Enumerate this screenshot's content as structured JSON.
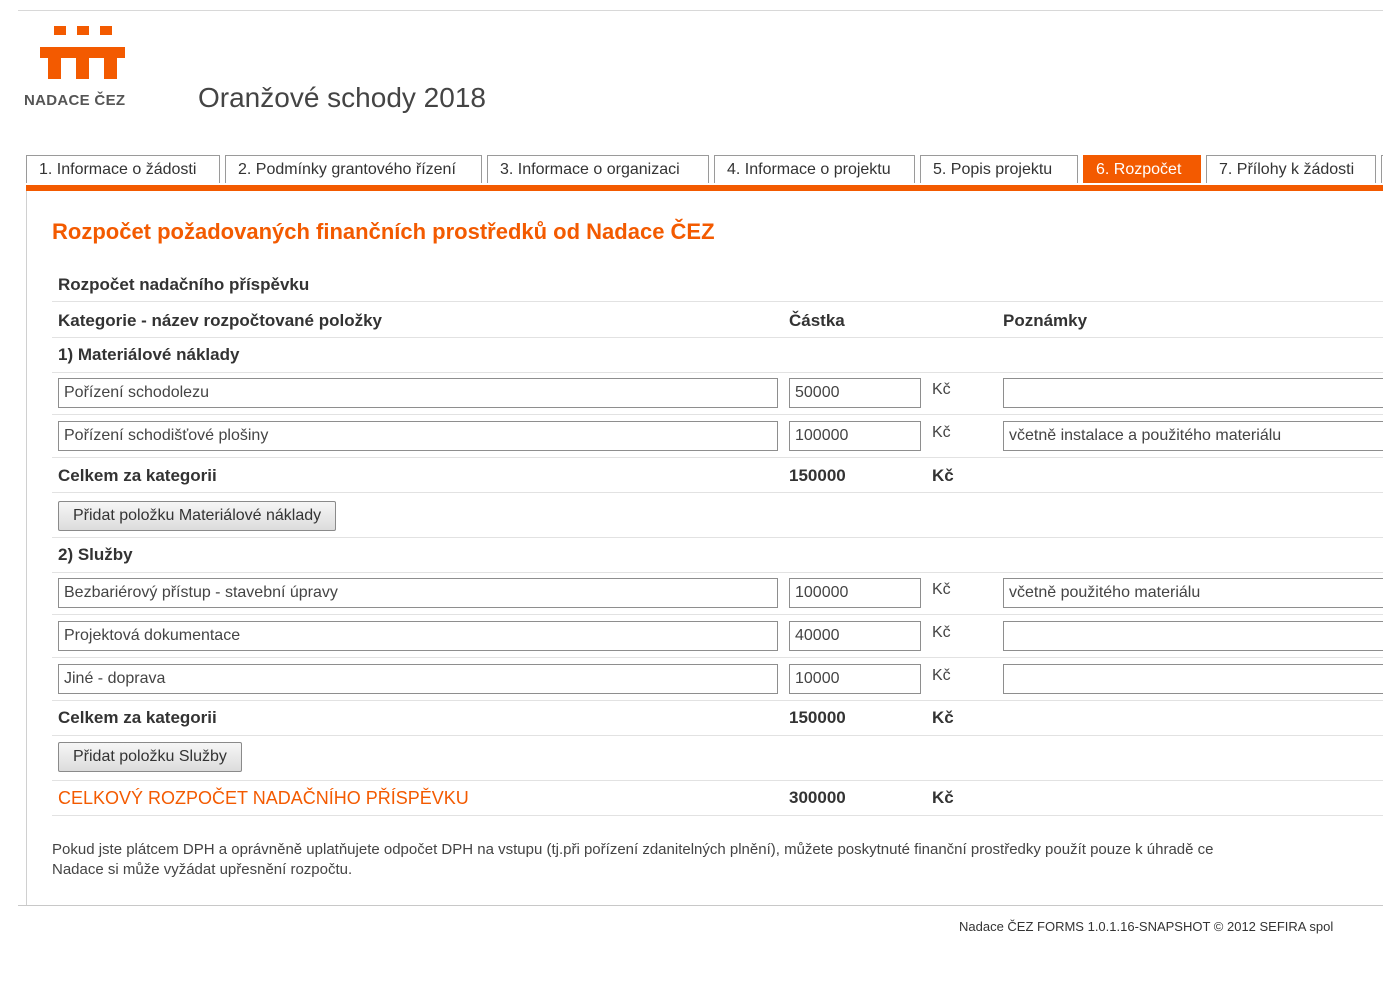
{
  "logo": {
    "brand": "NADACE ČEZ"
  },
  "app_title": "Oranžové schody 2018",
  "tabs": [
    {
      "label": "1. Informace o žádosti",
      "active": false
    },
    {
      "label": "2. Podmínky grantového řízení",
      "active": false
    },
    {
      "label": "3. Informace o organizaci",
      "active": false
    },
    {
      "label": "4. Informace o projektu",
      "active": false
    },
    {
      "label": "5. Popis projektu",
      "active": false
    },
    {
      "label": "6. Rozpočet",
      "active": true
    },
    {
      "label": "7. Přílohy k žádosti",
      "active": false
    }
  ],
  "page": {
    "heading": "Rozpočet požadovaných finančních prostředků od Nadace ČEZ",
    "section_title": "Rozpočet nadačního příspěvku",
    "columns": {
      "category": "Kategorie - název rozpočtované položky",
      "amount": "Částka",
      "notes": "Poznámky"
    },
    "currency": "Kč",
    "categories": [
      {
        "title": "1) Materiálové náklady",
        "items": [
          {
            "name": "Pořízení schodolezu",
            "amount": "50000",
            "note": ""
          },
          {
            "name": "Pořízení schodišťové plošiny",
            "amount": "100000",
            "note": "včetně instalace a použitého materiálu"
          }
        ],
        "total_label": "Celkem za kategorii",
        "total": "150000",
        "add_button": "Přidat položku Materiálové náklady"
      },
      {
        "title": "2) Služby",
        "items": [
          {
            "name": "Bezbariérový přístup - stavební úpravy",
            "amount": "100000",
            "note": "včetně použitého materiálu"
          },
          {
            "name": "Projektová dokumentace",
            "amount": "40000",
            "note": ""
          },
          {
            "name": "Jiné - doprava",
            "amount": "10000",
            "note": ""
          }
        ],
        "total_label": "Celkem za kategorii",
        "total": "150000",
        "add_button": "Přidat položku Služby"
      }
    ],
    "grand_total_label": "CELKOVÝ ROZPOČET NADAČNÍHO PŘÍSPĚVKU",
    "grand_total": "300000",
    "vat_note_line1": "Pokud jste plátcem DPH a oprávněně uplatňujete odpočet DPH na vstupu (tj.při pořízení zdanitelných plnění), můžete poskytnuté finanční prostředky použít pouze k úhradě ce",
    "vat_note_line2": "Nadace si může vyžádat upřesnění rozpočtu."
  },
  "footer": "Nadace ČEZ FORMS 1.0.1.16-SNAPSHOT © 2012 SEFIRA spol"
}
